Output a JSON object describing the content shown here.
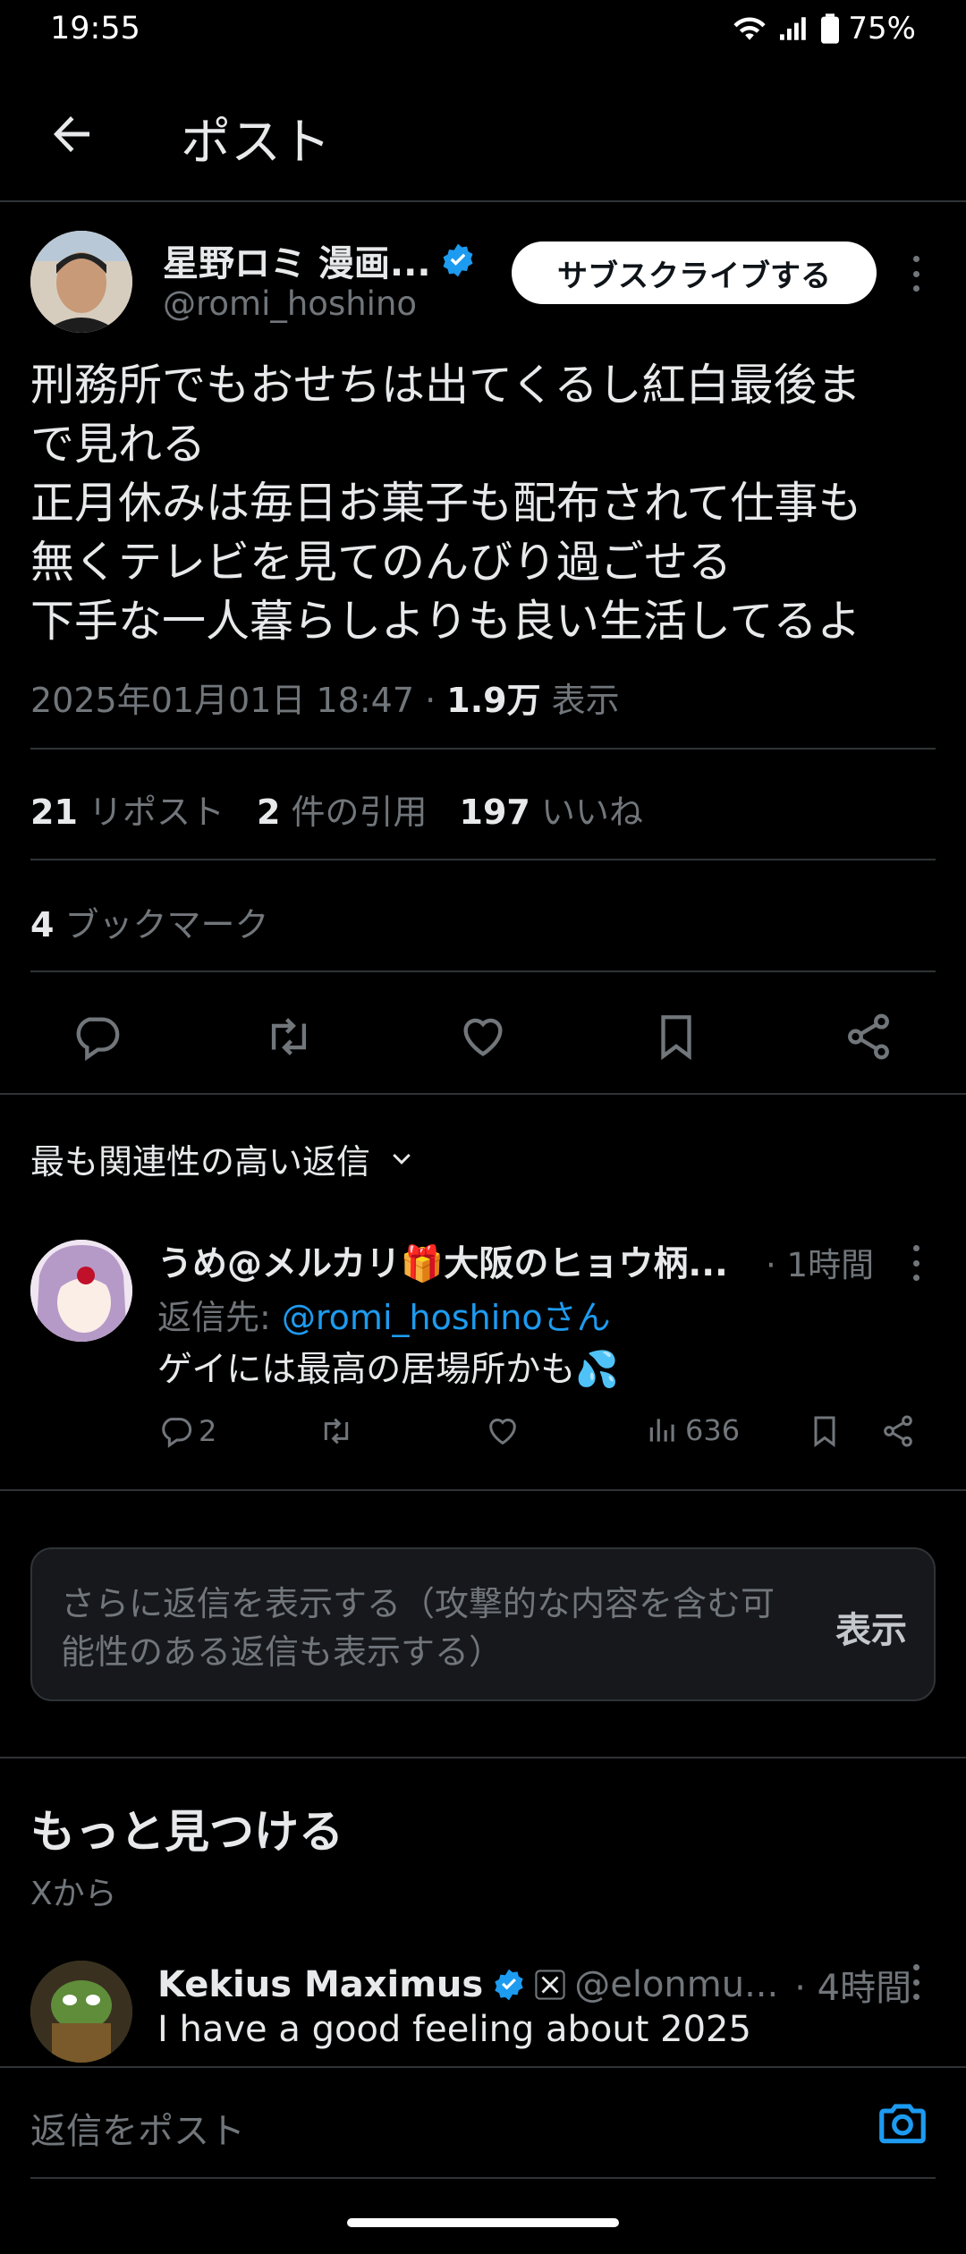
{
  "status_bar": {
    "time": "19:55",
    "battery": "75%"
  },
  "header": {
    "title": "ポスト"
  },
  "post": {
    "author_name": "星野ロミ 漫画...",
    "author_handle": "@romi_hoshino",
    "subscribe_label": "サブスクライブする",
    "text": "刑務所でもおせちは出てくるし紅白最後ま\nで見れる\n正月休みは毎日お菓子も配布されて仕事も\n無くテレビを見てのんびり過ごせる\n下手な一人暮らしよりも良い生活してるよ",
    "datetime": "2025年01月01日 18:47 · ",
    "views_count": "1.9万",
    "views_label": " 表示",
    "reposts_count": "21",
    "reposts_label": " リポスト",
    "quotes_count": "2",
    "quotes_label": " 件の引用",
    "likes_count": "197",
    "likes_label": " いいね",
    "bookmarks_count": "4",
    "bookmarks_label": " ブックマーク"
  },
  "replies_sort": {
    "label": "最も関連性の高い返信"
  },
  "reply": {
    "name": "うめ@メルカリ🎁大阪のヒョウ柄...",
    "time": "· 1時間",
    "reply_to_prefix": "返信先: ",
    "reply_to_handle": "@romi_hoshinoさん",
    "text": "ゲイには最高の居場所かも💦",
    "reply_count": "2",
    "view_count": "636"
  },
  "more_replies": {
    "text": "さらに返信を表示する（攻撃的な内容を含む可能性のある返信も表示する）",
    "button": "表示"
  },
  "discover": {
    "title": "もっと見つける",
    "subtitle": "Xから"
  },
  "suggested_post": {
    "name": "Kekius Maximus",
    "handle": "@elonmu...",
    "time": "· 4時間",
    "text": "I have a good feeling about 2025"
  },
  "compose": {
    "placeholder": "返信をポスト"
  },
  "colors": {
    "accent": "#1d9bf0",
    "muted": "#71767b",
    "divider": "#2f3336"
  }
}
